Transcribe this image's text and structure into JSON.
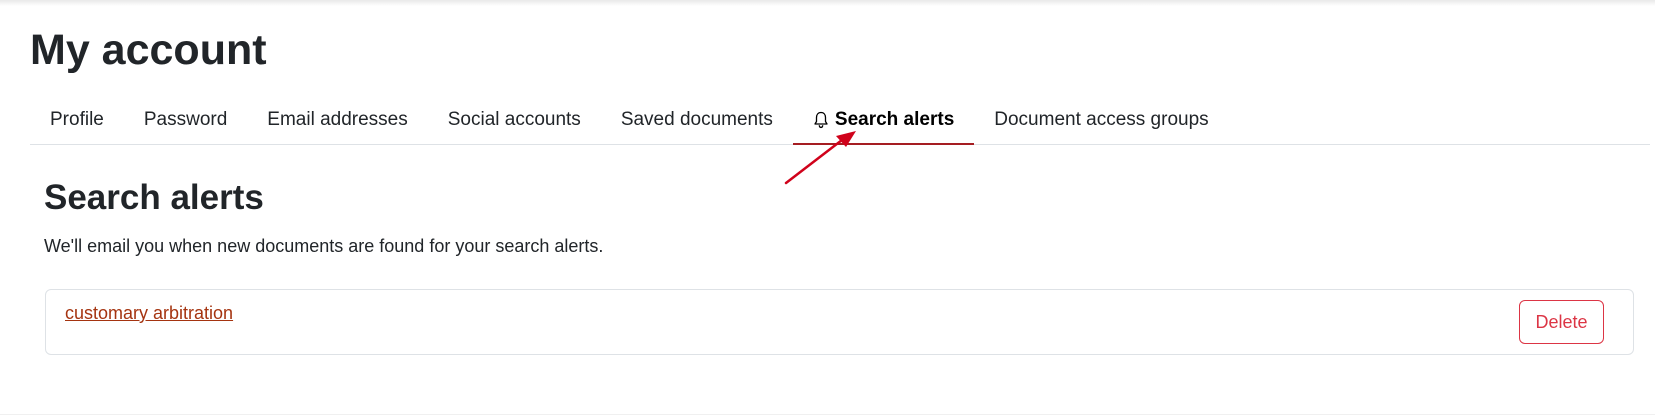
{
  "page": {
    "title": "My account"
  },
  "tabs": [
    {
      "label": "Profile",
      "active": false
    },
    {
      "label": "Password",
      "active": false
    },
    {
      "label": "Email addresses",
      "active": false
    },
    {
      "label": "Social accounts",
      "active": false
    },
    {
      "label": "Saved documents",
      "active": false
    },
    {
      "label": "Search alerts",
      "active": true,
      "icon": "bell-icon"
    },
    {
      "label": "Document access groups",
      "active": false
    }
  ],
  "section": {
    "title": "Search alerts",
    "description": "We'll email you when new documents are found for your search alerts."
  },
  "alerts": [
    {
      "query": "customary arbitration",
      "delete_label": "Delete"
    }
  ],
  "colors": {
    "accent": "#a51d22",
    "link": "#a53410",
    "danger": "#dc3545",
    "annotation": "#d0021b"
  }
}
